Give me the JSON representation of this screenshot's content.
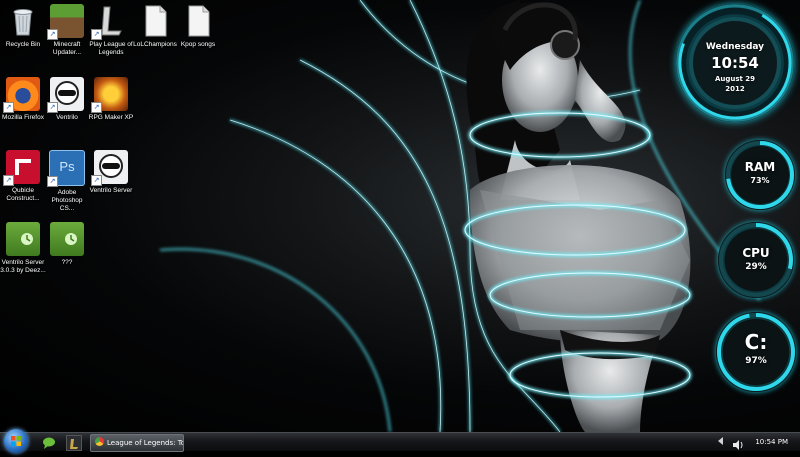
{
  "desktop": {
    "icons": [
      {
        "label": "Recycle Bin",
        "icon": "recycle-bin-icon"
      },
      {
        "label": "Minecraft Updater...",
        "icon": "minecraft-icon"
      },
      {
        "label": "Play League of Legends",
        "icon": "league-of-legends-icon"
      },
      {
        "label": "LoLChampions",
        "icon": "blank-file-icon"
      },
      {
        "label": "Kpop songs",
        "icon": "blank-file-icon"
      },
      {
        "label": "Mozilla Firefox",
        "icon": "firefox-icon"
      },
      {
        "label": "Ventrilo",
        "icon": "ventrilo-icon"
      },
      {
        "label": "RPG Maker XP",
        "icon": "rpg-maker-icon"
      },
      {
        "label": "Qubicle Construct...",
        "icon": "qubicle-icon"
      },
      {
        "label": "Adobe Photoshop CS...",
        "icon": "photoshop-icon"
      },
      {
        "label": "Ventrilo Server",
        "icon": "ventrilo-icon"
      },
      {
        "label": "Ventrilo Server 3.0.3 by Deez...",
        "icon": "winrar-folder-icon"
      },
      {
        "label": "???",
        "icon": "winrar-folder-icon"
      }
    ]
  },
  "widgets": {
    "clock": {
      "day": "Wednesday",
      "time": "10:54",
      "date": "August 29",
      "year": "2012"
    },
    "ram": {
      "label": "RAM",
      "value": "73%",
      "fraction": 0.73
    },
    "cpu": {
      "label": "CPU",
      "value": "29%",
      "fraction": 0.29
    },
    "disk": {
      "label": "C:",
      "value": "97%",
      "fraction": 0.97
    },
    "accent": "#26c6da"
  },
  "taskbar": {
    "task_item": "League of Legends: Token I...",
    "clock": "10:54 PM",
    "quick_launch": [
      "chat-bubble-icon",
      "league-of-legends-icon"
    ],
    "tray": [
      "arrow-icon",
      "speaker-icon"
    ]
  }
}
